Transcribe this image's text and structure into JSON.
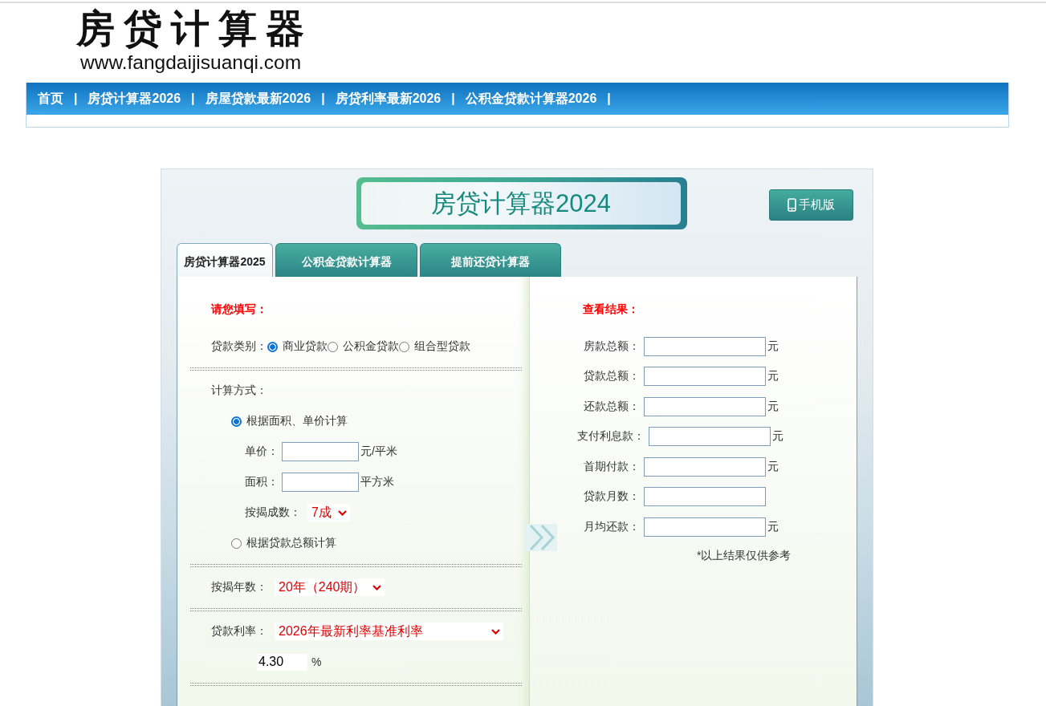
{
  "header": {
    "logo_title": "房贷计算器",
    "site_url": "www.fangdaijisuanqi.com"
  },
  "nav": {
    "items": [
      {
        "label": "首页",
        "separator": "|"
      },
      {
        "label": "房贷计算器2026",
        "separator": "|"
      },
      {
        "label": "房屋贷款最新2026",
        "separator": "|"
      },
      {
        "label": "房贷利率最新2026",
        "separator": "|"
      },
      {
        "label": "公积金贷款计算器2026",
        "separator": "|"
      }
    ]
  },
  "calculator": {
    "title": "房贷计算器2024",
    "mobile_button": "手机版",
    "tabs": [
      {
        "label": "房贷计算器2025",
        "selected": true
      },
      {
        "label": "公积金贷款计算器",
        "selected": false
      },
      {
        "label": "提前还贷计算器",
        "selected": false
      }
    ],
    "form": {
      "heading": "请您填写：",
      "loan_type": {
        "label": "贷款类别：",
        "options": [
          {
            "label": "商业贷款",
            "selected": true
          },
          {
            "label": "公积金贷款",
            "selected": false
          },
          {
            "label": "组合型贷款",
            "selected": false
          }
        ]
      },
      "method": {
        "label": "计算方式：",
        "options": [
          {
            "label": "根据面积、单价计算",
            "selected": true,
            "fields": [
              {
                "kind": "input",
                "label": "单价：",
                "unit": "元/平米"
              },
              {
                "kind": "input",
                "label": "面积：",
                "unit": "平方米"
              },
              {
                "kind": "select",
                "label": "按揭成数：",
                "value": "7成"
              }
            ]
          },
          {
            "label": "根据贷款总额计算",
            "selected": false
          }
        ]
      },
      "term": {
        "label": "按揭年数：",
        "value": "20年（240期）"
      },
      "rate": {
        "label": "贷款利率：",
        "value": "2026年最新利率基准利率"
      },
      "rate_value": {
        "value": "4.30",
        "unit": "%"
      }
    },
    "results": {
      "heading": "查看结果：",
      "rows": [
        {
          "label": "房款总额：",
          "unit": "元"
        },
        {
          "label": "贷款总额：",
          "unit": "元"
        },
        {
          "label": "还款总额：",
          "unit": "元"
        },
        {
          "label": "支付利息款：",
          "unit": "元"
        },
        {
          "label": "首期付款：",
          "unit": "元"
        },
        {
          "label": "贷款月数："
        },
        {
          "label": "月均还款：",
          "unit": "元"
        }
      ],
      "note": "*以上结果仅供参考"
    }
  }
}
